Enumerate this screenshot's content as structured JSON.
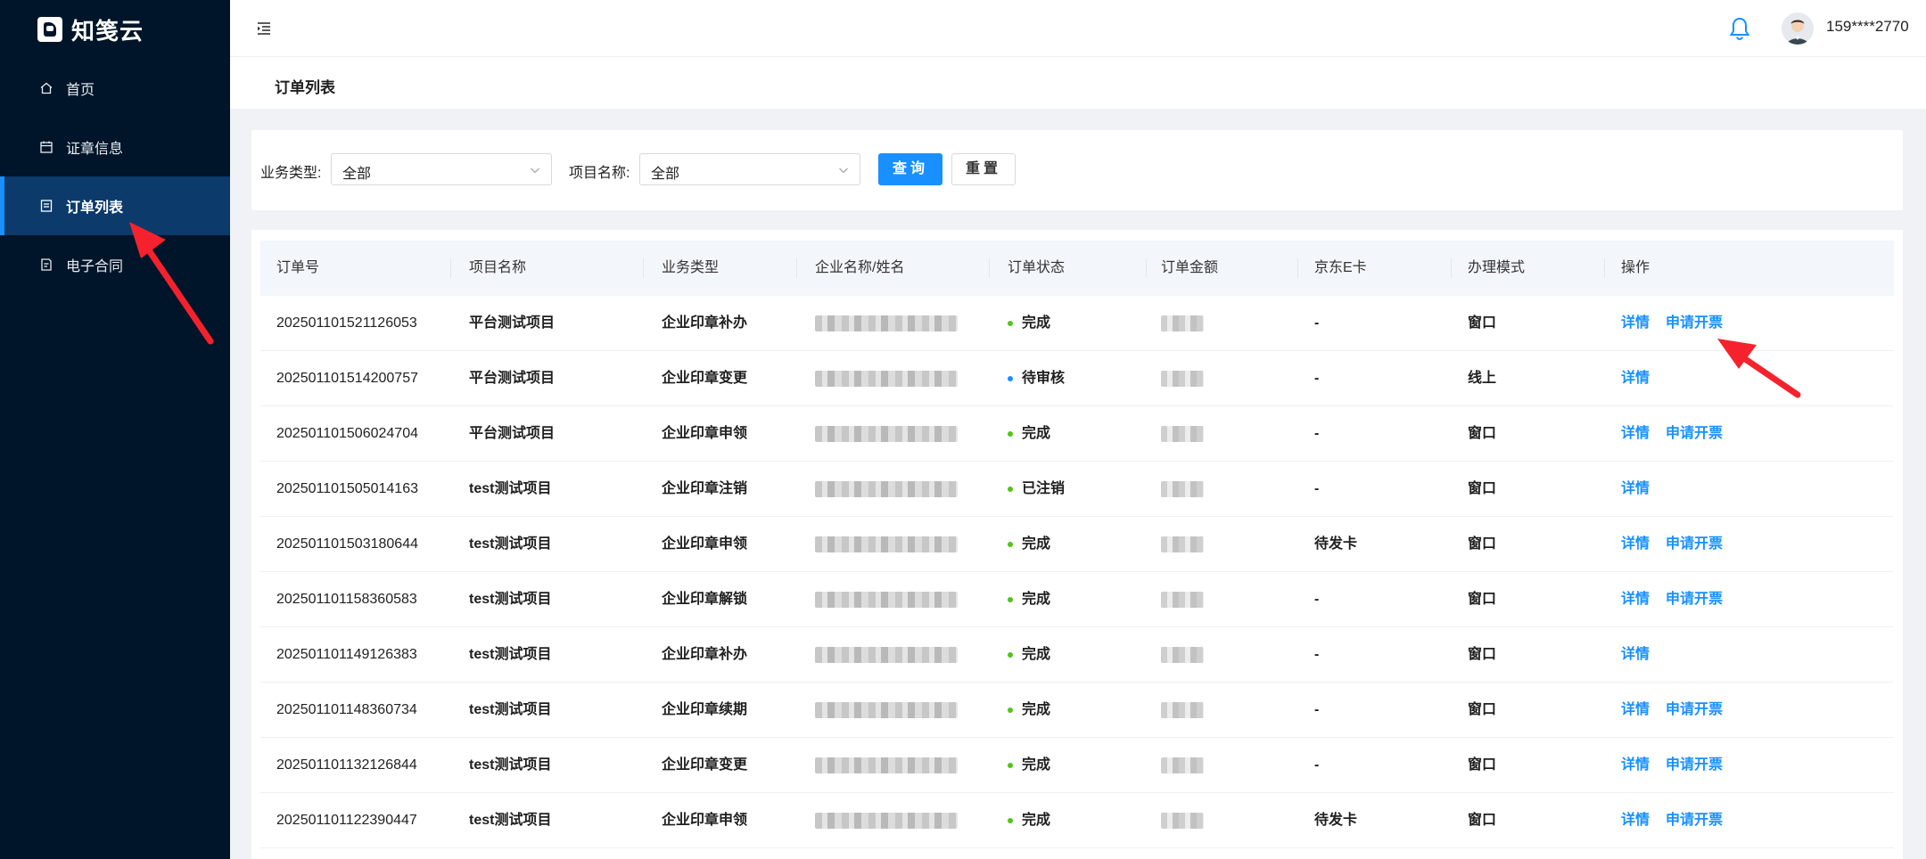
{
  "app": {
    "brand": "知笺云"
  },
  "sidebar": {
    "items": [
      {
        "label": "首页",
        "icon": "home-icon"
      },
      {
        "label": "证章信息",
        "icon": "calendar-icon"
      },
      {
        "label": "订单列表",
        "icon": "list-icon",
        "active": true
      },
      {
        "label": "电子合同",
        "icon": "contract-icon"
      }
    ]
  },
  "header": {
    "username": "159****2770"
  },
  "page": {
    "title": "订单列表"
  },
  "filters": {
    "business_type_label": "业务类型:",
    "business_type_value": "全部",
    "project_name_label": "项目名称:",
    "project_name_value": "全部",
    "query_label": "查询",
    "reset_label": "重置"
  },
  "table": {
    "columns": [
      "订单号",
      "项目名称",
      "业务类型",
      "企业名称/姓名",
      "订单状态",
      "订单金额",
      "京东E卡",
      "办理模式",
      "操作"
    ],
    "detail_label": "详情",
    "invoice_label": "申请开票",
    "rows": [
      {
        "order_no": "202501101521126053",
        "project": "平台测试项目",
        "biz_type": "企业印章补办",
        "status": "完成",
        "jd_card": "-",
        "mode": "窗口",
        "invoice": true
      },
      {
        "order_no": "202501101514200757",
        "project": "平台测试项目",
        "biz_type": "企业印章变更",
        "status": "待审核",
        "jd_card": "-",
        "mode": "线上",
        "invoice": false
      },
      {
        "order_no": "202501101506024704",
        "project": "平台测试项目",
        "biz_type": "企业印章申领",
        "status": "完成",
        "jd_card": "-",
        "mode": "窗口",
        "invoice": true
      },
      {
        "order_no": "202501101505014163",
        "project": "test测试项目",
        "biz_type": "企业印章注销",
        "status": "已注销",
        "jd_card": "-",
        "mode": "窗口",
        "invoice": false
      },
      {
        "order_no": "202501101503180644",
        "project": "test测试项目",
        "biz_type": "企业印章申领",
        "status": "完成",
        "jd_card": "待发卡",
        "mode": "窗口",
        "invoice": true
      },
      {
        "order_no": "202501101158360583",
        "project": "test测试项目",
        "biz_type": "企业印章解锁",
        "status": "完成",
        "jd_card": "-",
        "mode": "窗口",
        "invoice": true
      },
      {
        "order_no": "202501101149126383",
        "project": "test测试项目",
        "biz_type": "企业印章补办",
        "status": "完成",
        "jd_card": "-",
        "mode": "窗口",
        "invoice": false
      },
      {
        "order_no": "202501101148360734",
        "project": "test测试项目",
        "biz_type": "企业印章续期",
        "status": "完成",
        "jd_card": "-",
        "mode": "窗口",
        "invoice": true
      },
      {
        "order_no": "202501101132126844",
        "project": "test测试项目",
        "biz_type": "企业印章变更",
        "status": "完成",
        "jd_card": "-",
        "mode": "窗口",
        "invoice": true
      },
      {
        "order_no": "202501101122390447",
        "project": "test测试项目",
        "biz_type": "企业印章申领",
        "status": "完成",
        "jd_card": "待发卡",
        "mode": "窗口",
        "invoice": true
      }
    ]
  },
  "colors": {
    "accent": "#1890ff",
    "sidebar_bg": "#001529",
    "status_done": "#52c41a",
    "status_pending": "#1890ff",
    "annotation": "#f5222d"
  }
}
